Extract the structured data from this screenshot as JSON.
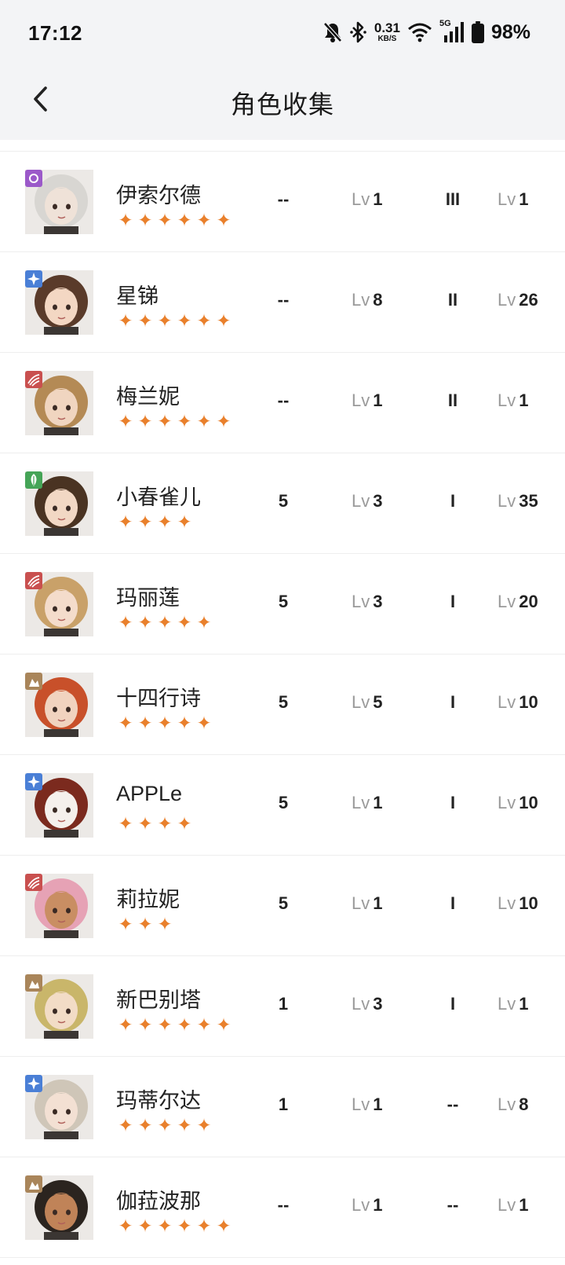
{
  "status_bar": {
    "time": "17:12",
    "net_speed_value": "0.31",
    "net_speed_unit": "KB/S",
    "network": "5G",
    "battery": "98%",
    "icons": [
      "bell-muted-icon",
      "bluetooth-icon",
      "wifi-icon",
      "cellular-signal-icon",
      "battery-icon"
    ]
  },
  "nav": {
    "back_icon": "chevron-left-icon",
    "title": "角色收集"
  },
  "level_prefix": "Lv",
  "star_glyph": "✦",
  "colors": {
    "star": "#e9802c",
    "element_purple": "#9b59c9",
    "element_blue": "#4a7fd6",
    "element_red": "#c9504f",
    "element_green": "#45a457",
    "element_tan": "#a9855a"
  },
  "characters": [
    {
      "name": "伊索尔德",
      "stars": 6,
      "element": "purple",
      "col1": "--",
      "lv1": "1",
      "grade": "III",
      "lv2": "1"
    },
    {
      "name": "星锑",
      "stars": 6,
      "element": "blue",
      "col1": "--",
      "lv1": "8",
      "grade": "II",
      "lv2": "26"
    },
    {
      "name": "梅兰妮",
      "stars": 6,
      "element": "red",
      "col1": "--",
      "lv1": "1",
      "grade": "II",
      "lv2": "1"
    },
    {
      "name": "小春雀儿",
      "stars": 4,
      "element": "green",
      "col1": "5",
      "lv1": "3",
      "grade": "I",
      "lv2": "35"
    },
    {
      "name": "玛丽莲",
      "stars": 5,
      "element": "red",
      "col1": "5",
      "lv1": "3",
      "grade": "I",
      "lv2": "20"
    },
    {
      "name": "十四行诗",
      "stars": 5,
      "element": "tan",
      "col1": "5",
      "lv1": "5",
      "grade": "I",
      "lv2": "10"
    },
    {
      "name": "APPLe",
      "stars": 4,
      "element": "blue",
      "col1": "5",
      "lv1": "1",
      "grade": "I",
      "lv2": "10"
    },
    {
      "name": "莉拉妮",
      "stars": 3,
      "element": "red",
      "col1": "5",
      "lv1": "1",
      "grade": "I",
      "lv2": "10"
    },
    {
      "name": "新巴别塔",
      "stars": 6,
      "element": "tan",
      "col1": "1",
      "lv1": "3",
      "grade": "I",
      "lv2": "1"
    },
    {
      "name": "玛蒂尔达",
      "stars": 5,
      "element": "blue",
      "col1": "1",
      "lv1": "1",
      "grade": "--",
      "lv2": "8"
    },
    {
      "name": "伽菈波那",
      "stars": 6,
      "element": "tan",
      "col1": "--",
      "lv1": "1",
      "grade": "--",
      "lv2": "1"
    }
  ]
}
